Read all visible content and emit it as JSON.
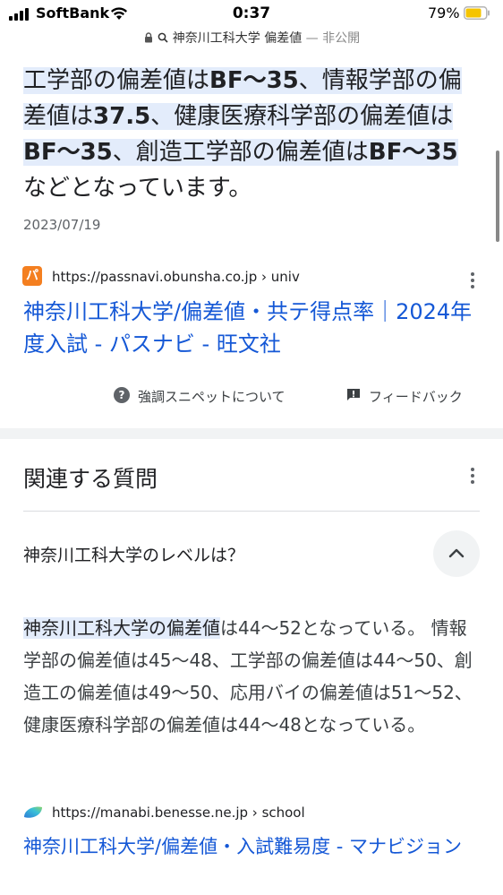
{
  "status_bar": {
    "carrier": "SoftBank",
    "time": "0:37",
    "battery_percent": "79%",
    "battery_level": 0.79,
    "url_title": "神奈川工科大学 偏差値",
    "url_mode": "— 非公開"
  },
  "snippet": {
    "parts": [
      "工学部の偏差値は",
      "BF〜35",
      "、情報学部の偏差値は",
      "37.5",
      "、健康医療科学部の偏差値は",
      "BF〜35",
      "、創造工学部の偏差値は",
      "BF〜35",
      "などとなっています。"
    ],
    "date": "2023/07/19"
  },
  "source1": {
    "favicon_letter": "パ",
    "url": "https://passnavi.obunsha.co.jp › univ",
    "title": "神奈川工科大学/偏差値・共テ得点率｜2024年度入試 - パスナビ - 旺文社",
    "favicon_color": "#f47f20"
  },
  "feedback": {
    "help_label": "強調スニペットについて",
    "feedback_label": "フィードバック"
  },
  "related": {
    "heading": "関連する質問",
    "question": "神奈川工科大学のレベルは？",
    "answer_highlight": "神奈川工科大学の偏差値",
    "answer_rest": "は44〜52となっている。 情報学部の偏差値は45〜48、工学部の偏差値は44〜50、創造工の偏差値は49〜50、応用バイの偏差値は51〜52、健康医療科学部の偏差値は44〜48となっている。"
  },
  "source2": {
    "url": "https://manabi.benesse.ne.jp › school",
    "title": "神奈川工科大学/偏差値・入試難易度 - マナビジョン"
  },
  "colors": {
    "link": "#1558d6",
    "highlight": "#e3ecfb",
    "battery": "#f5c400"
  }
}
